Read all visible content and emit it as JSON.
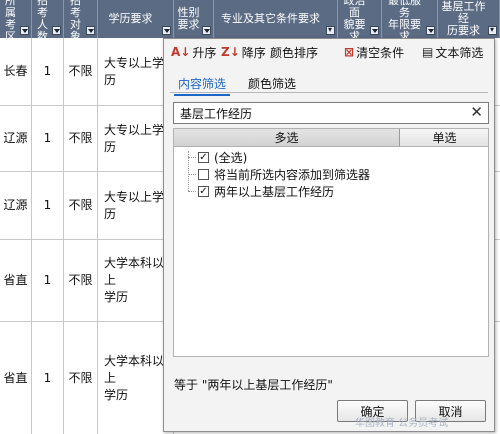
{
  "headers": [
    {
      "label": "所属\n考区",
      "icon": "dropdown-arrow-icon"
    },
    {
      "label": "招考\n人数",
      "icon": "dropdown-arrow-icon"
    },
    {
      "label": "招考\n对象",
      "icon": "dropdown-arrow-icon"
    },
    {
      "label": "学历要求",
      "icon": "dropdown-arrow-icon"
    },
    {
      "label": "性别\n要求",
      "icon": "dropdown-arrow-icon"
    },
    {
      "label": "专业及其它条件要求",
      "icon": "filter-active-icon"
    },
    {
      "label": "政治面\n貌要求",
      "icon": "dropdown-arrow-icon"
    },
    {
      "label": "最低服务\n年限要求",
      "icon": "dropdown-arrow-icon"
    },
    {
      "label": "基层工作经\n历要求",
      "icon": "filter-active-icon"
    }
  ],
  "rows": [
    {
      "area": "长春",
      "count": "1",
      "target": "不限",
      "edu": "大专以上学历"
    },
    {
      "area": "辽源",
      "count": "1",
      "target": "不限",
      "edu": "大专以上学历"
    },
    {
      "area": "辽源",
      "count": "1",
      "target": "不限",
      "edu": "大专以上学历"
    },
    {
      "area": "省直",
      "count": "1",
      "target": "不限",
      "edu": "大学本科以上\n学历"
    },
    {
      "area": "省直",
      "count": "1",
      "target": "不限",
      "edu": "大学本科以上\n学历"
    }
  ],
  "filter_panel": {
    "sort_asc": "升序",
    "sort_desc": "降序",
    "sort_color": "颜色排序",
    "clear": "清空条件",
    "text_filter": "文本筛选",
    "tab_content": "内容筛选",
    "tab_color": "颜色筛选",
    "search_value": "基层工作经历",
    "mode_multi": "多选",
    "mode_single": "单选",
    "options": [
      {
        "label": "(全选)",
        "checked": true
      },
      {
        "label": "将当前所选内容添加到筛选器",
        "checked": false
      },
      {
        "label": "两年以上基层工作经历",
        "checked": true
      }
    ],
    "status": "等于 \"两年以上基层工作经历\"",
    "ok": "确定",
    "cancel": "取消"
  },
  "watermark": "华图教育 公务员考试"
}
